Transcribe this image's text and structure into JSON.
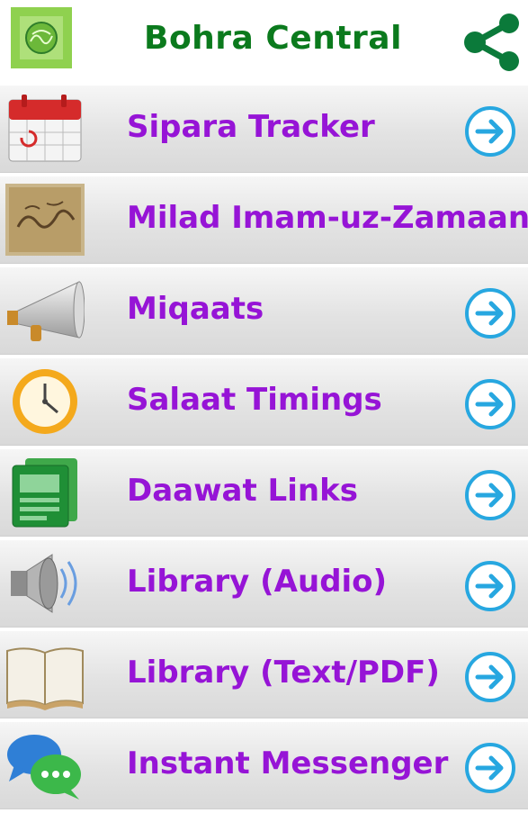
{
  "app": {
    "title": "Bohra Central",
    "logo_icon": "calligraphy-logo",
    "share_icon": "share-icon",
    "title_color": "#0b7a1d",
    "accent": "#9614d6",
    "arrow_color": "#27a7e0"
  },
  "menu": {
    "items": [
      {
        "label": "Sipara Tracker",
        "icon": "calendar-icon",
        "has_arrow": true
      },
      {
        "label": "Milad Imam-uz-Zamaan",
        "icon": "calligraphy-icon",
        "has_arrow": false
      },
      {
        "label": "Miqaats",
        "icon": "megaphone-icon",
        "has_arrow": true
      },
      {
        "label": "Salaat Timings",
        "icon": "clock-icon",
        "has_arrow": true
      },
      {
        "label": "Daawat Links",
        "icon": "documents-icon",
        "has_arrow": true
      },
      {
        "label": "Library (Audio)",
        "icon": "speaker-icon",
        "has_arrow": true
      },
      {
        "label": "Library (Text/PDF)",
        "icon": "book-icon",
        "has_arrow": true
      },
      {
        "label": "Instant Messenger",
        "icon": "chat-bubbles-icon",
        "has_arrow": true
      }
    ]
  }
}
